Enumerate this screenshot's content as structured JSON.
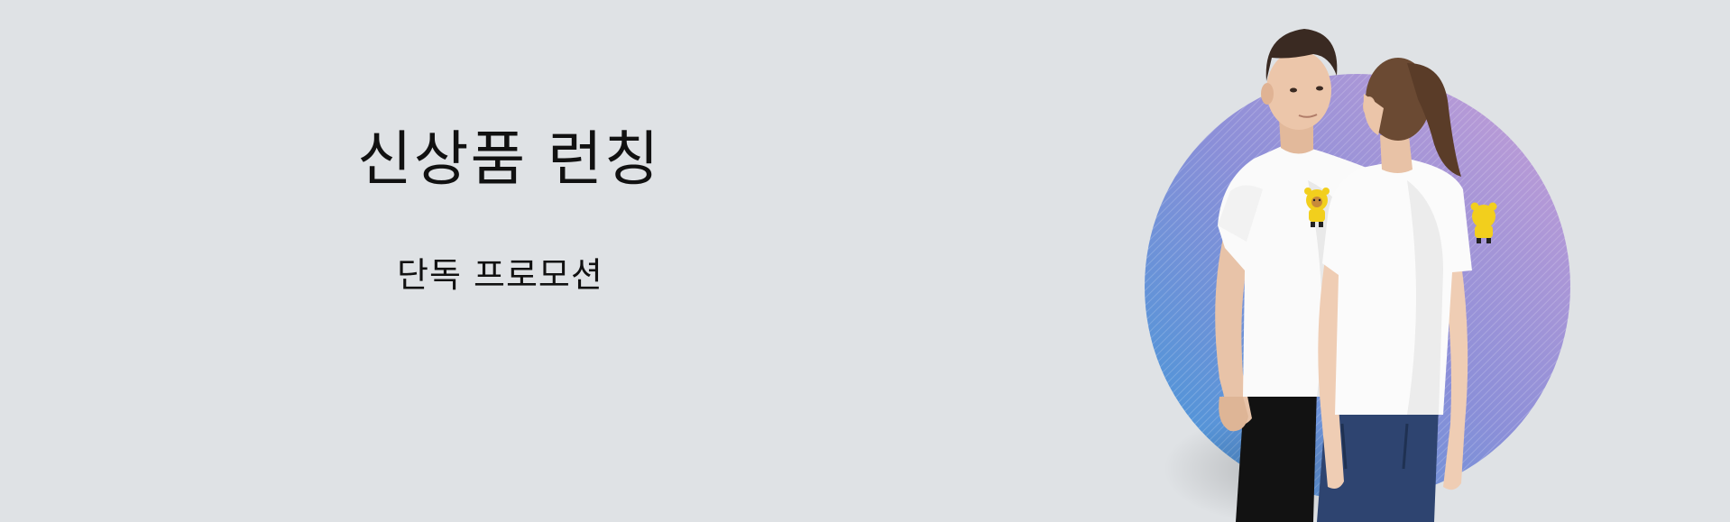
{
  "banner": {
    "headline": "신상품 런칭",
    "subline": "단독 프로모션"
  },
  "icons": {
    "hero_image": "couple-tshirt-photo",
    "mascot": "yellow-bear-mascot"
  },
  "colors": {
    "background": "#dfe2e5",
    "circle_blue": "#4a95d6",
    "circle_purple": "#b89ad8",
    "mascot_yellow": "#f2cf1d"
  }
}
